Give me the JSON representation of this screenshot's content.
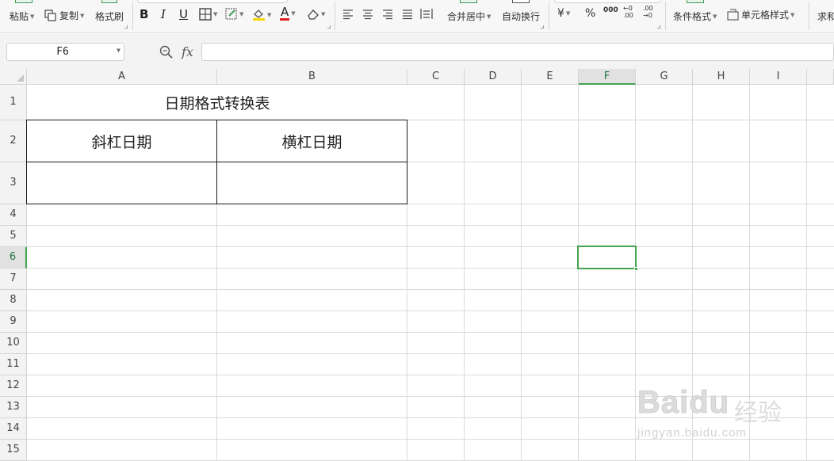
{
  "ribbon": {
    "paste": "粘贴",
    "copy": "复制",
    "format_painter": "格式刷",
    "bold": "B",
    "italic": "I",
    "underline": "U",
    "font_color_glyph": "A",
    "merge_center": "合并居中",
    "wrap_text": "自动换行",
    "currency": "¥",
    "percent": "%",
    "thousands": "000",
    "dec_increase": "←0\n.00",
    "dec_decrease": ".00\n→0",
    "conditional_format": "条件格式",
    "cell_style": "单元格样式",
    "sum": "求和",
    "accent_color": "#3d9a52"
  },
  "formula_bar": {
    "name_box": "F6",
    "fx_label": "fx",
    "formula_value": ""
  },
  "sheet": {
    "columns": [
      "A",
      "B",
      "C",
      "D",
      "E",
      "F",
      "G",
      "H",
      "I"
    ],
    "rows": [
      "1",
      "2",
      "3",
      "4",
      "5",
      "6",
      "7",
      "8",
      "9",
      "10",
      "11",
      "12",
      "13",
      "14",
      "15"
    ],
    "active_cell": "F6",
    "selected_column": "F",
    "selected_row": "6",
    "cells": {
      "A1": "日期格式转换表",
      "A2": "斜杠日期",
      "B2": "横杠日期",
      "A3": "",
      "B3": ""
    }
  },
  "watermark": {
    "brand": "Baidu",
    "brand_cn": "经验",
    "url": "jingyan.baidu.com"
  }
}
